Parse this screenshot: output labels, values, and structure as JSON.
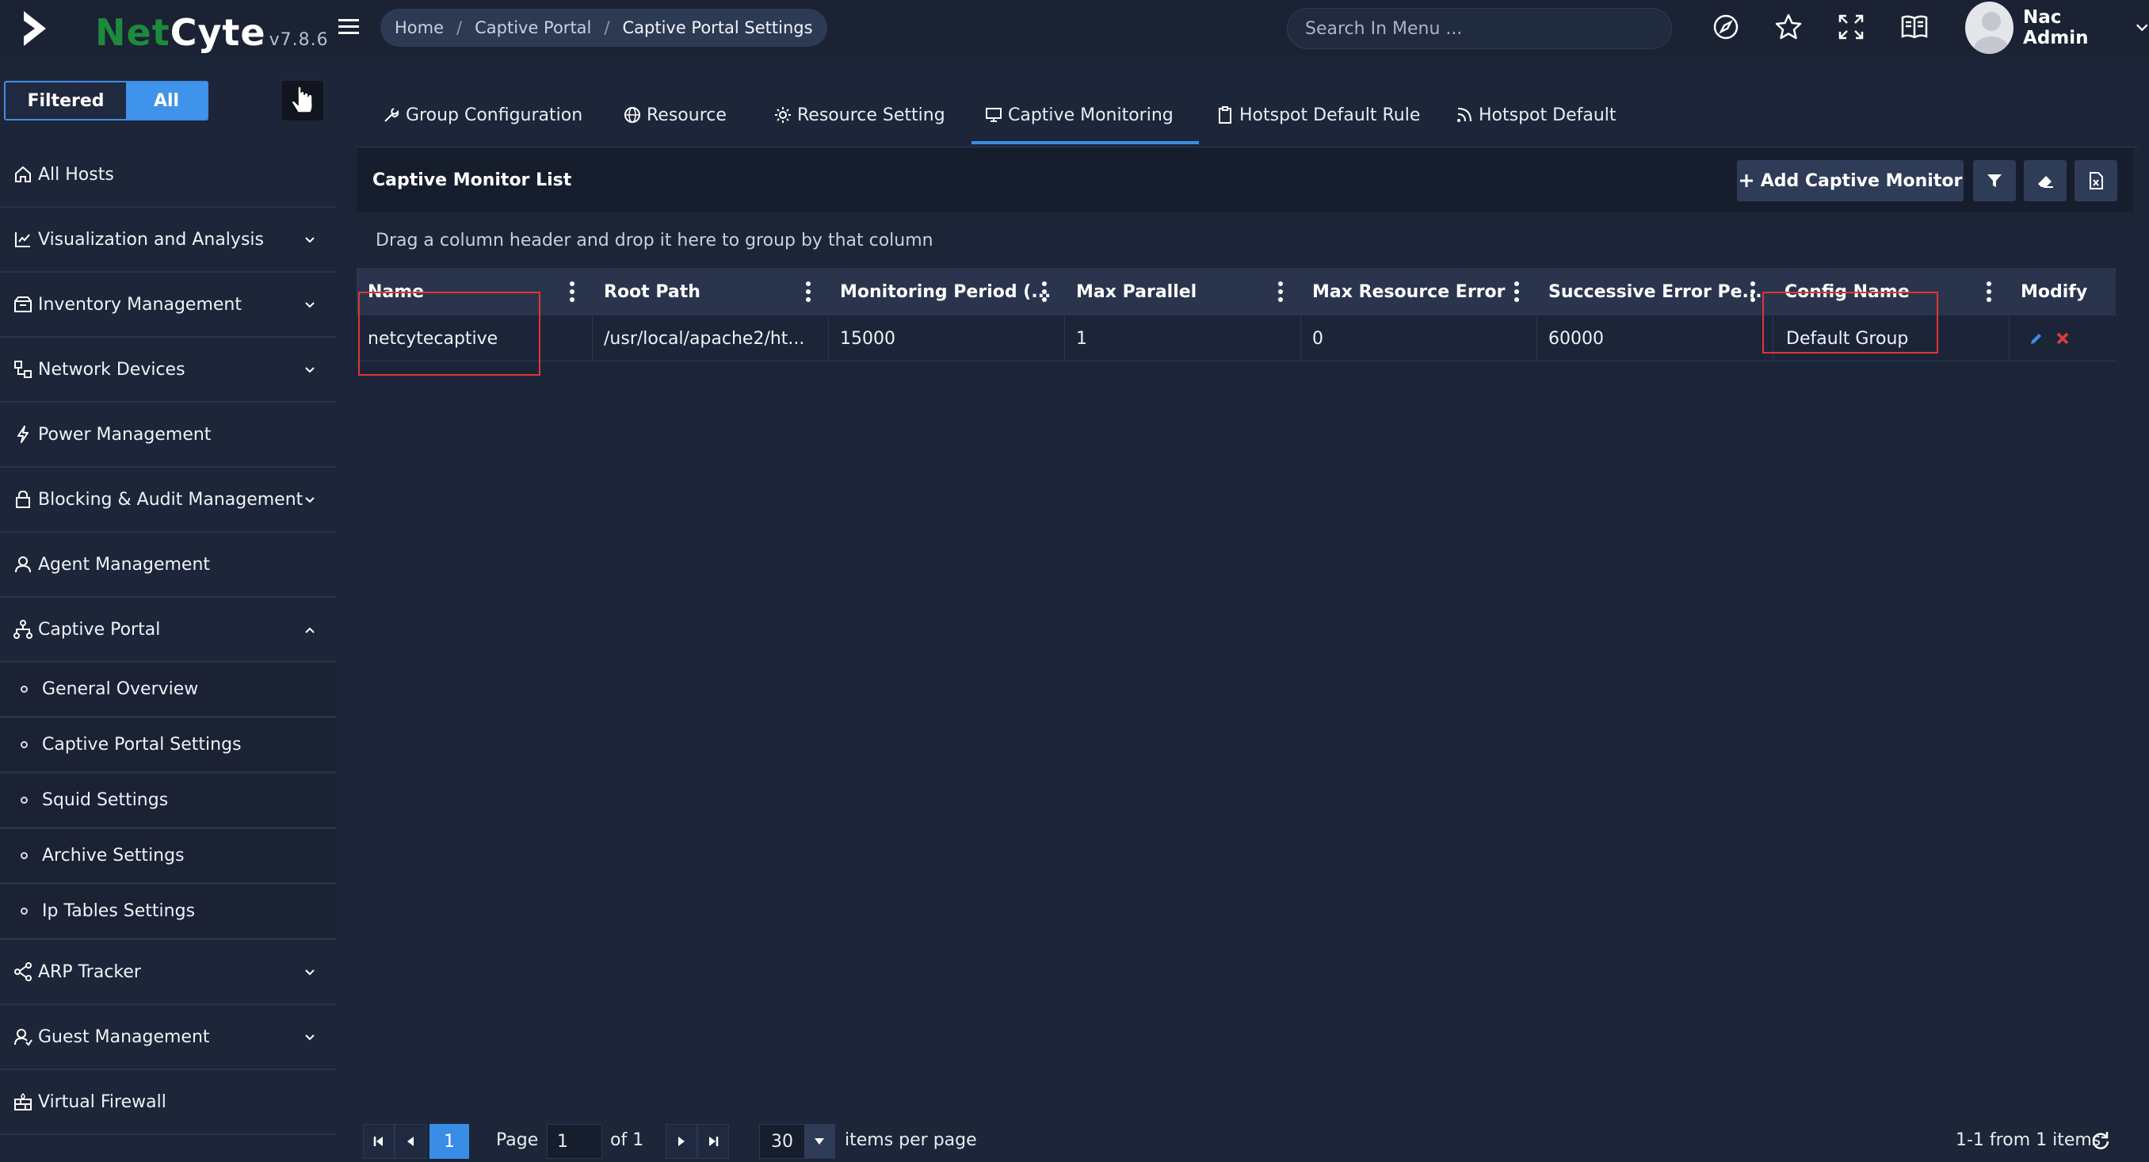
{
  "brand": {
    "part1": "Net",
    "part2": "Cyte",
    "version": "v7.8.6"
  },
  "breadcrumb": {
    "home": "Home",
    "section": "Captive Portal",
    "current": "Captive Portal Settings",
    "sep": "/"
  },
  "search": {
    "placeholder": "Search In Menu ..."
  },
  "user": {
    "name": "Nac Admin"
  },
  "sidebar": {
    "filter_toggle": {
      "filtered": "Filtered",
      "all": "All",
      "active": "All"
    },
    "items": [
      {
        "label": "All Hosts",
        "icon": "home-icon",
        "expandable": false
      },
      {
        "label": "Visualization and Analysis",
        "icon": "chart-icon",
        "expandable": true
      },
      {
        "label": "Inventory Management",
        "icon": "inventory-icon",
        "expandable": true
      },
      {
        "label": "Network Devices",
        "icon": "network-icon",
        "expandable": true
      },
      {
        "label": "Power Management",
        "icon": "bolt-icon",
        "expandable": false
      },
      {
        "label": "Blocking & Audit Management",
        "icon": "lock-icon",
        "expandable": true
      },
      {
        "label": "Agent Management",
        "icon": "agent-icon",
        "expandable": false
      },
      {
        "label": "Captive Portal",
        "icon": "sitemap-icon",
        "expandable": true,
        "open": true
      },
      {
        "label": "ARP Tracker",
        "icon": "share-icon",
        "expandable": true
      },
      {
        "label": "Guest Management",
        "icon": "guest-icon",
        "expandable": true
      },
      {
        "label": "Virtual Firewall",
        "icon": "firewall-icon",
        "expandable": false
      }
    ],
    "captive_sub": [
      {
        "label": "General Overview"
      },
      {
        "label": "Captive Portal Settings"
      },
      {
        "label": "Squid Settings"
      },
      {
        "label": "Archive Settings"
      },
      {
        "label": "Ip Tables Settings"
      }
    ]
  },
  "tabs": [
    {
      "label": "Group Configuration",
      "icon": "wrench-icon"
    },
    {
      "label": "Resource",
      "icon": "globe-icon"
    },
    {
      "label": "Resource Setting",
      "icon": "gear-icon"
    },
    {
      "label": "Captive Monitoring",
      "icon": "monitor-icon",
      "active": true
    },
    {
      "label": "Hotspot Default Rule",
      "icon": "clipboard-icon"
    },
    {
      "label": "Hotspot Default",
      "icon": "rss-icon"
    }
  ],
  "list": {
    "title": "Captive Monitor List",
    "add_button": "Add Captive Monitor",
    "group_hint": "Drag a column header and drop it here to group by that column",
    "columns": [
      "Name",
      "Root Path",
      "Monitoring Period (...",
      "Max Parallel",
      "Max Resource Error",
      "Successive Error Pe...",
      "Config Name",
      "Modify"
    ],
    "rows": [
      {
        "name": "netcytecaptive",
        "root_path": "/usr/local/apache2/ht...",
        "monitoring_period": "15000",
        "max_parallel": "1",
        "max_resource_error": "0",
        "successive_error": "60000",
        "config_name": "Default Group"
      }
    ]
  },
  "pager": {
    "current_page": "1",
    "page_label": "Page",
    "page_input": "1",
    "of_label": "of 1",
    "page_size": "30",
    "per_page_label": "items per page",
    "summary": "1-1 from 1 items"
  },
  "colors": {
    "accent": "#3b8de5",
    "brand_green": "#1d8a3c",
    "highlight": "#e03535",
    "edit": "#3b8de5",
    "delete": "#e23b3b"
  }
}
